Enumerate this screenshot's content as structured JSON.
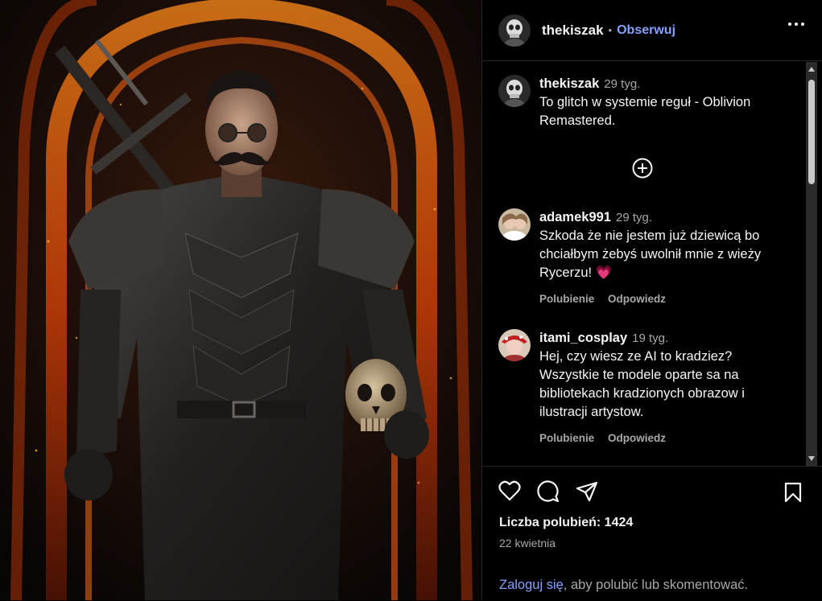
{
  "post": {
    "username": "thekiszak",
    "follow_label": "Obserwuj",
    "separator": "•"
  },
  "caption": {
    "username": "thekiszak",
    "time": "29 tyg.",
    "text": "To glitch w systemie reguł - Oblivion Remastered."
  },
  "comments": [
    {
      "username": "adamek991",
      "time": "29 tyg.",
      "text": "Szkoda że nie jestem już dziewicą bo chciałbym żebyś uwolnił mnie z wieży Rycerzu! 💗",
      "like_label": "Polubienie",
      "reply_label": "Odpowiedz"
    },
    {
      "username": "itami_cosplay",
      "time": "19 tyg.",
      "text": "Hej, czy wiesz ze AI to kradziez? Wszystkie te modele oparte sa na bibliotekach kradzionych obrazow i ilustracji artystow.",
      "like_label": "Polubienie",
      "reply_label": "Odpowiedz"
    }
  ],
  "footer": {
    "likes": "Liczba polubień: 1424",
    "date": "22 kwietnia",
    "login_link": "Zaloguj się",
    "login_rest": ", aby polubić lub skomentować."
  },
  "icons": {
    "like": "heart-icon",
    "comment": "comment-icon",
    "share": "share-icon",
    "save": "bookmark-icon",
    "more": "more-icon",
    "load_more": "plus-circle-icon"
  },
  "colors": {
    "background": "#000000",
    "accent_link": "#85a0ff",
    "secondary_text": "#a8a8a8",
    "fire": "#ff5a10"
  }
}
